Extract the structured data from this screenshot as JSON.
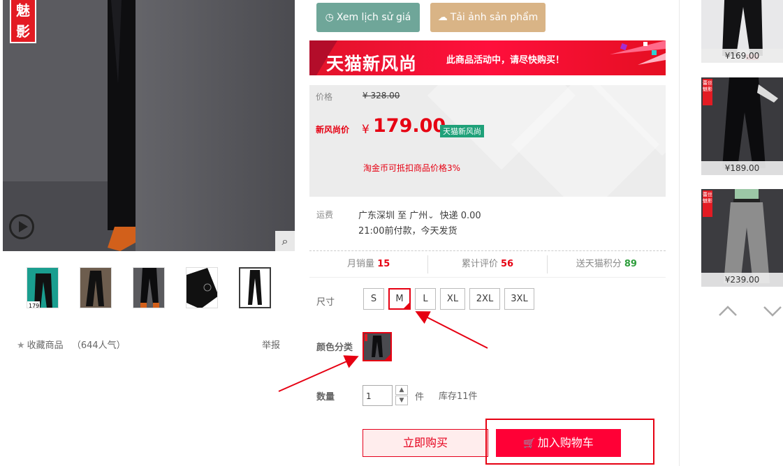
{
  "gallery": {
    "brand_badge_text": "魅影",
    "play_icon": "play-icon",
    "zoom_icon": "search-icon",
    "thumb_labels": [
      "179",
      "",
      "",
      "",
      ""
    ],
    "favorite": {
      "icon": "star-icon",
      "label": "收藏商品",
      "popularity": "（644人气）"
    },
    "report_label": "举报"
  },
  "actions_top": {
    "history_label": "Xem lịch sử giá",
    "download_label": "Tải ảnh sản phẩm"
  },
  "promo": {
    "title": "天猫新风尚",
    "message": "此商品活动中，请尽快购买！"
  },
  "price": {
    "orig_label": "价格",
    "orig_value": "¥ 328.00",
    "promo_label": "新风尚价",
    "currency_symbol": "¥",
    "promo_value": "179.00",
    "promo_tag": "天猫新风尚",
    "coin_note": "淘金币可抵扣商品价格3%"
  },
  "shipping": {
    "label": "运费",
    "route": "广东深圳  至  广州",
    "method": "快递 0.00",
    "dispatch": "21:00前付款，今天发货"
  },
  "stats": [
    {
      "label": "月销量",
      "value": "15"
    },
    {
      "label": "累计评价",
      "value": "56"
    },
    {
      "label": "送天猫积分",
      "value": "89"
    }
  ],
  "size": {
    "label": "尺寸",
    "options": [
      "S",
      "M",
      "L",
      "XL",
      "2XL",
      "3XL"
    ],
    "selected": "M"
  },
  "color": {
    "label": "颜色分类"
  },
  "quantity": {
    "label": "数量",
    "value": "1",
    "unit": "件",
    "stock": "库存11件"
  },
  "buttons": {
    "buy_now": "立即购买",
    "add_cart": "加入购物车"
  },
  "side": {
    "cards": [
      {
        "price": "¥169.00",
        "badge": ""
      },
      {
        "price": "¥189.00",
        "badge": "蕾丝魅影"
      },
      {
        "price": "¥239.00",
        "badge": "蕾丝魅影"
      }
    ],
    "up_icon": "chevron-up-icon",
    "down_icon": "chevron-down-icon"
  },
  "colors": {
    "accent_red": "#e60012",
    "history_btn": "#6fa699",
    "download_btn": "#d9b486",
    "tag_green": "#1fa179"
  }
}
